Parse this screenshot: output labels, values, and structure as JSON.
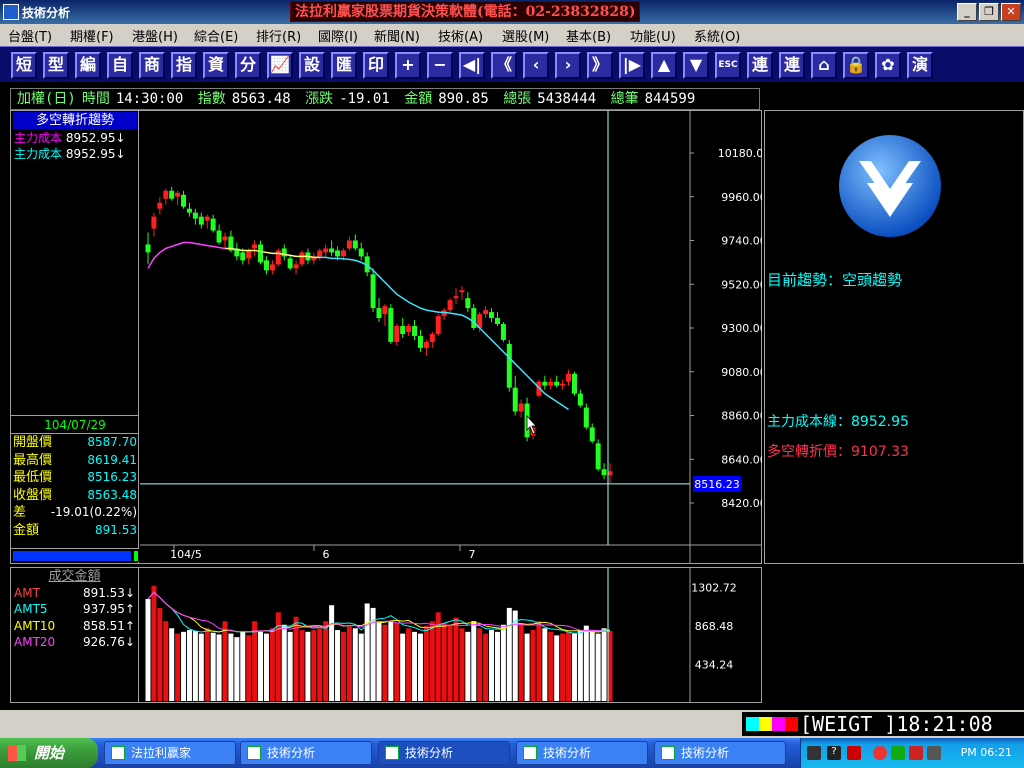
{
  "window": {
    "title": "技術分析",
    "banner": "法拉利贏家股票期貨決策軟體(電話：02-23832828)",
    "btn_min": "_",
    "btn_max": "❐",
    "btn_close": "✕"
  },
  "menu": [
    "台盤(T)",
    "期權(F)",
    "港盤(H)",
    "綜合(E)",
    "排行(R)",
    "國際(I)",
    "新聞(N)",
    "技術(A)",
    "選股(M)",
    "基本(B)",
    "功能(U)",
    "系統(O)"
  ],
  "toolbar": [
    "短",
    "型",
    "編",
    "自",
    "商",
    "指",
    "資",
    "分",
    "📈",
    "設",
    "匯",
    "印",
    "+",
    "−",
    "◀|",
    "《",
    "‹",
    "›",
    "》",
    "|▶",
    "▲",
    "▼",
    "ESC",
    "連",
    "連",
    "⌂",
    "🔒",
    "✿",
    "演"
  ],
  "info": {
    "market": "加權(日)",
    "time_label": "時間",
    "time": "14:30:00",
    "index_label": "指數",
    "index": "8563.48",
    "change_label": "漲跌",
    "change": "-19.01",
    "amount_label": "金額",
    "amount": "890.85",
    "volume_label": "總張",
    "volume": "5438444",
    "count_label": "總筆",
    "count": "844599"
  },
  "indicator": {
    "title": "多空轉折趨勢",
    "line1_label": "主力成本",
    "line1_value": "8952.95↓",
    "line1_color": "#ff00ff",
    "line2_label": "主力成本",
    "line2_value": "8952.95↓",
    "line2_color": "#00ffff"
  },
  "quote": {
    "date": "104/07/29",
    "rows": [
      {
        "k": "開盤價",
        "v": "8587.70"
      },
      {
        "k": "最高價",
        "v": "8619.41"
      },
      {
        "k": "最低價",
        "v": "8516.23"
      },
      {
        "k": "收盤價",
        "v": "8563.48"
      },
      {
        "k": "差",
        "v": "-19.01(0.22%)"
      },
      {
        "k": "金額",
        "v": "891.53"
      }
    ]
  },
  "price_axis": [
    "10180.00",
    "9960.00",
    "9740.00",
    "9520.00",
    "9300.00",
    "9080.00",
    "8860.00",
    "8640.00",
    "8420.00"
  ],
  "price_cursor": "8516.23",
  "date_axis": [
    "104/5",
    "6",
    "7"
  ],
  "right": {
    "trend": "目前趨勢：空頭趨勢",
    "cost_line": "主力成本線：8952.95",
    "turn_price": "多空轉折價：9107.33",
    "cost_color": "#00ffff",
    "turn_color": "#ff3050"
  },
  "vol": {
    "title": "成交金額",
    "rows": [
      {
        "k": "AMT",
        "v": "891.53↓",
        "c": "#ff4040"
      },
      {
        "k": "AMT5",
        "v": "937.95↑",
        "c": "#00ffff"
      },
      {
        "k": "AMT10",
        "v": "858.51↑",
        "c": "#ffff00"
      },
      {
        "k": "AMT20",
        "v": "926.76↓",
        "c": "#ff40ff"
      }
    ],
    "axis": [
      "1302.72",
      "868.48",
      "434.24"
    ]
  },
  "status": {
    "label": "[WEIGT  ]18:21:08"
  },
  "taskbar": {
    "start": "開始",
    "tasks": [
      "法拉利贏家",
      "技術分析",
      "技術分析",
      "技術分析",
      "技術分析"
    ],
    "clock": "PM 06:21"
  },
  "chart_data": {
    "type": "candlestick",
    "ylim": [
      8420,
      10180
    ],
    "candles": [
      [
        9720,
        9780,
        9620,
        9680
      ],
      [
        9800,
        9880,
        9760,
        9860
      ],
      [
        9900,
        9960,
        9870,
        9930
      ],
      [
        9950,
        10000,
        9920,
        9990
      ],
      [
        9990,
        10010,
        9940,
        9950
      ],
      [
        9960,
        9990,
        9920,
        9980
      ],
      [
        9970,
        9990,
        9900,
        9910
      ],
      [
        9900,
        9930,
        9860,
        9880
      ],
      [
        9880,
        9900,
        9820,
        9850
      ],
      [
        9860,
        9880,
        9800,
        9820
      ],
      [
        9840,
        9870,
        9800,
        9860
      ],
      [
        9850,
        9870,
        9780,
        9790
      ],
      [
        9790,
        9820,
        9720,
        9730
      ],
      [
        9740,
        9780,
        9700,
        9760
      ],
      [
        9760,
        9790,
        9680,
        9690
      ],
      [
        9700,
        9730,
        9640,
        9660
      ],
      [
        9680,
        9700,
        9620,
        9640
      ],
      [
        9650,
        9700,
        9620,
        9690
      ],
      [
        9700,
        9740,
        9660,
        9720
      ],
      [
        9720,
        9740,
        9620,
        9630
      ],
      [
        9640,
        9660,
        9570,
        9590
      ],
      [
        9590,
        9640,
        9570,
        9620
      ],
      [
        9620,
        9700,
        9610,
        9690
      ],
      [
        9700,
        9720,
        9640,
        9660
      ],
      [
        9650,
        9670,
        9590,
        9600
      ],
      [
        9600,
        9640,
        9570,
        9620
      ],
      [
        9620,
        9690,
        9610,
        9680
      ],
      [
        9680,
        9700,
        9620,
        9640
      ],
      [
        9640,
        9680,
        9620,
        9660
      ],
      [
        9660,
        9700,
        9640,
        9690
      ],
      [
        9680,
        9720,
        9660,
        9700
      ],
      [
        9700,
        9740,
        9660,
        9680
      ],
      [
        9690,
        9710,
        9640,
        9660
      ],
      [
        9660,
        9700,
        9640,
        9690
      ],
      [
        9700,
        9760,
        9690,
        9740
      ],
      [
        9740,
        9770,
        9690,
        9700
      ],
      [
        9700,
        9730,
        9640,
        9660
      ],
      [
        9660,
        9680,
        9560,
        9580
      ],
      [
        9570,
        9600,
        9380,
        9400
      ],
      [
        9400,
        9450,
        9330,
        9350
      ],
      [
        9370,
        9420,
        9310,
        9410
      ],
      [
        9400,
        9420,
        9220,
        9230
      ],
      [
        9230,
        9320,
        9210,
        9310
      ],
      [
        9310,
        9350,
        9250,
        9270
      ],
      [
        9280,
        9320,
        9260,
        9310
      ],
      [
        9310,
        9340,
        9240,
        9260
      ],
      [
        9260,
        9290,
        9180,
        9200
      ],
      [
        9200,
        9240,
        9160,
        9230
      ],
      [
        9230,
        9280,
        9200,
        9270
      ],
      [
        9270,
        9370,
        9260,
        9360
      ],
      [
        9360,
        9400,
        9340,
        9390
      ],
      [
        9390,
        9450,
        9380,
        9440
      ],
      [
        9450,
        9500,
        9420,
        9460
      ],
      [
        9480,
        9510,
        9440,
        9490
      ],
      [
        9450,
        9480,
        9380,
        9400
      ],
      [
        9400,
        9420,
        9290,
        9300
      ],
      [
        9300,
        9380,
        9280,
        9370
      ],
      [
        9370,
        9410,
        9350,
        9390
      ],
      [
        9380,
        9400,
        9330,
        9350
      ],
      [
        9350,
        9380,
        9310,
        9320
      ],
      [
        9320,
        9330,
        9230,
        9240
      ],
      [
        9220,
        9240,
        8980,
        9000
      ],
      [
        9000,
        9060,
        8860,
        8880
      ],
      [
        8880,
        8940,
        8850,
        8920
      ],
      [
        8920,
        8950,
        8730,
        8750
      ],
      [
        8760,
        8820,
        8740,
        8800
      ],
      [
        8960,
        9040,
        8950,
        9030
      ],
      [
        9030,
        9060,
        8990,
        9010
      ],
      [
        9010,
        9050,
        8990,
        9030
      ],
      [
        9030,
        9060,
        9000,
        9010
      ],
      [
        9010,
        9040,
        8990,
        9020
      ],
      [
        9030,
        9090,
        9010,
        9070
      ],
      [
        9070,
        9080,
        8960,
        8970
      ],
      [
        8970,
        8990,
        8900,
        8910
      ],
      [
        8900,
        8920,
        8790,
        8800
      ],
      [
        8800,
        8820,
        8720,
        8730
      ],
      [
        8720,
        8740,
        8580,
        8590
      ],
      [
        8590,
        8620,
        8540,
        8560
      ],
      [
        8560,
        8620,
        8520,
        8580
      ]
    ],
    "avg_line": [
      9600,
      9650,
      9680,
      9700,
      9710,
      9720,
      9730,
      9730,
      9725,
      9720,
      9715,
      9710,
      9705,
      9700,
      9700,
      9695,
      9690,
      9690,
      9690,
      9685,
      9680,
      9675,
      9675,
      9670,
      9665,
      9660,
      9660,
      9660,
      9655,
      9655,
      9655,
      9650,
      9650,
      9648,
      9645,
      9640,
      9630,
      9615,
      9590,
      9560,
      9530,
      9500,
      9470,
      9450,
      9430,
      9415,
      9400,
      9390,
      9385,
      9380,
      9378,
      9375,
      9370,
      9365,
      9350,
      9330,
      9300,
      9270,
      9240,
      9210,
      9180,
      9150,
      9120,
      9090,
      9060,
      9030,
      9000,
      8970,
      8950,
      8930,
      8910,
      8890
    ]
  }
}
